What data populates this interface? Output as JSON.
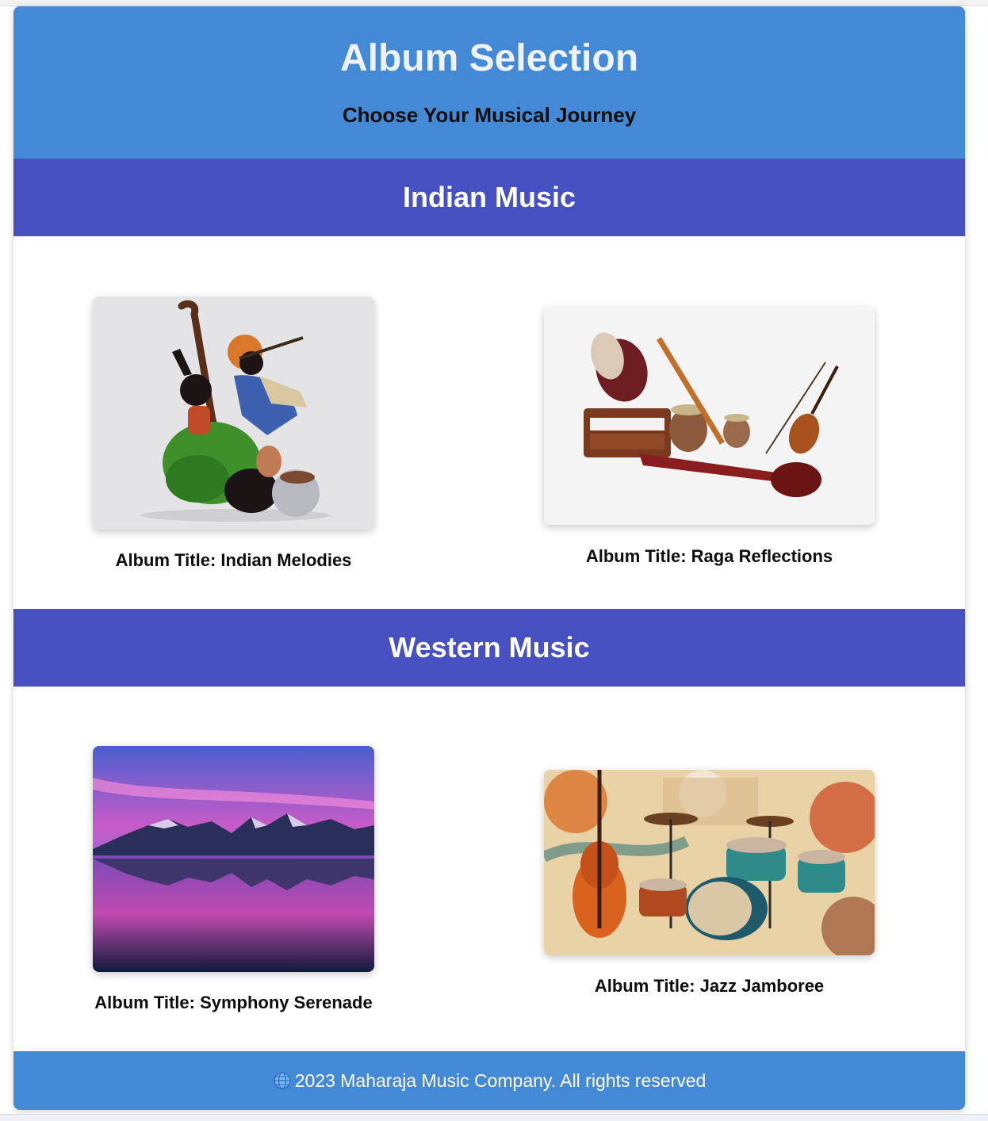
{
  "header": {
    "title": "Album Selection",
    "subtitle": "Choose Your Musical Journey"
  },
  "sections": [
    {
      "heading": "Indian Music",
      "albums": [
        {
          "title": "Album Title: Indian Melodies",
          "image": "indian-musicians-sculpture"
        },
        {
          "title": "Album Title: Raga Reflections",
          "image": "indian-instruments"
        }
      ]
    },
    {
      "heading": "Western Music",
      "albums": [
        {
          "title": "Album Title: Symphony Serenade",
          "image": "mountain-lake-sunset"
        },
        {
          "title": "Album Title: Jazz Jamboree",
          "image": "jazz-instruments-collage"
        }
      ]
    }
  ],
  "footer": {
    "text": "2023 Maharaja Music Company. All rights reserved",
    "icon": "globe-icon"
  },
  "colors": {
    "header_bg": "#4489d6",
    "section_bar_bg": "#4650c0",
    "footer_bg": "#4489d6"
  }
}
